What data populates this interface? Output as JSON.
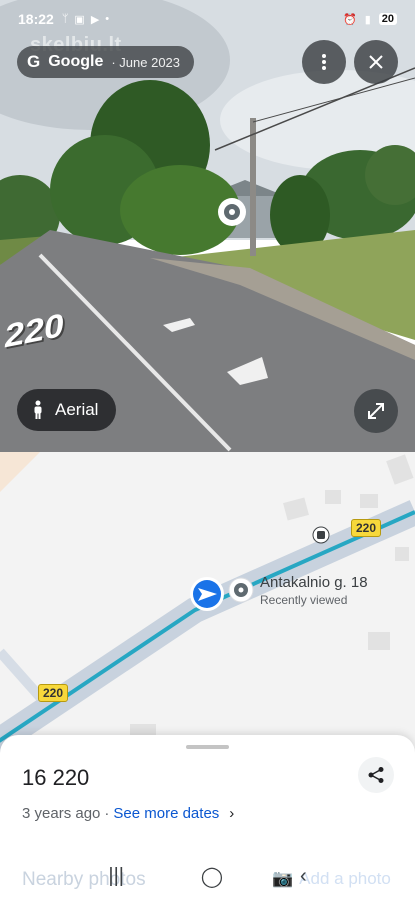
{
  "status_bar": {
    "time": "18:22",
    "battery": "20"
  },
  "watermark": "skelbiu.lt",
  "street_view": {
    "brand_g": "G",
    "brand": "Google",
    "capture_date": "· June 2023",
    "road_marking": "220",
    "aerial_label": "Aerial"
  },
  "map": {
    "route_shield_1": "220",
    "route_shield_2": "220",
    "place_title": "Antakalnio g. 18",
    "place_subtitle": "Recently viewed"
  },
  "sheet": {
    "title": "16 220",
    "age": "3 years ago",
    "separator": "·",
    "see_more": "See more dates",
    "chevron": "›",
    "nearby_photos": "Nearby photos",
    "add_photo": "Add a photo"
  },
  "icons": {
    "more": "more-vert-icon",
    "close": "close-icon",
    "expand": "expand-icon",
    "share": "share-icon",
    "person": "person-icon",
    "nav_arrow": "navigation-arrow-icon"
  },
  "colors": {
    "accent_blue": "#1a73e8",
    "link_blue": "#0b57d0",
    "road_cyan": "#27a7c3",
    "shield_yellow": "#f7d83b"
  }
}
